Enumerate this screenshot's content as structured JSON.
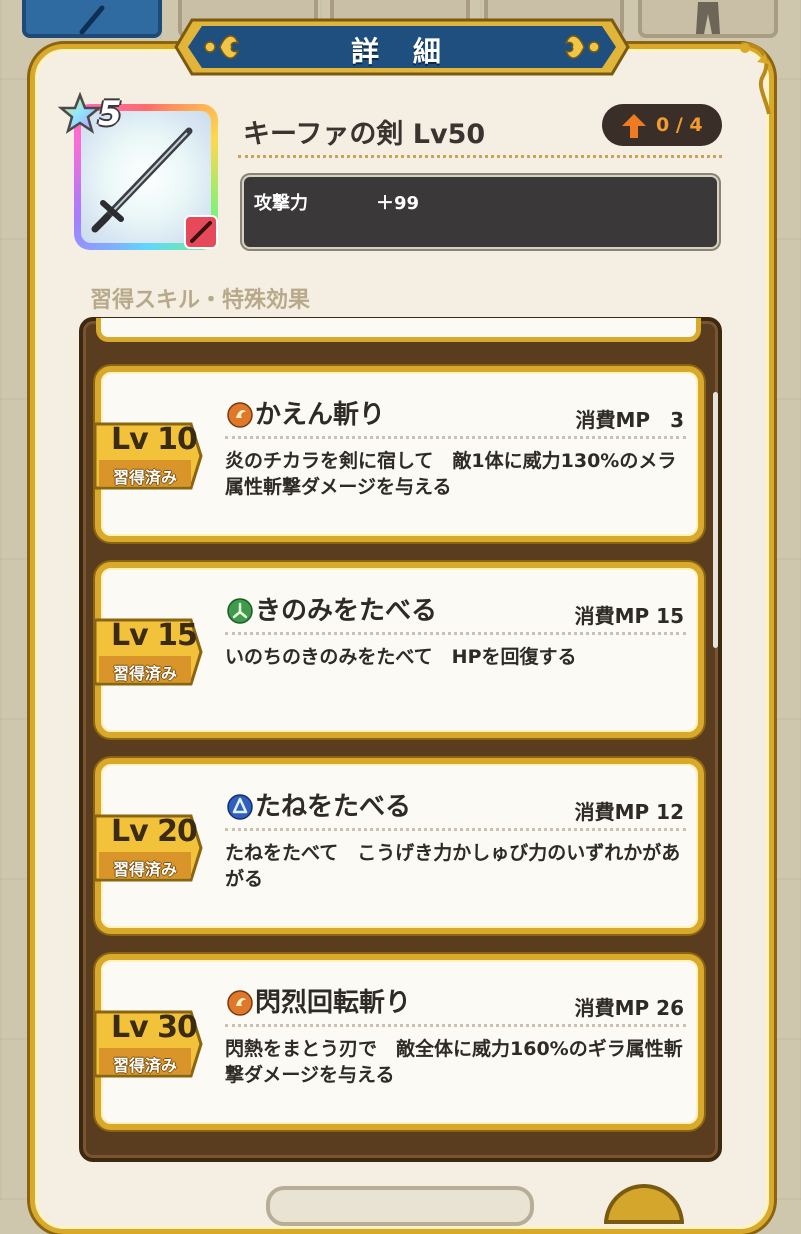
{
  "header": {
    "title": "詳 細"
  },
  "item": {
    "rarity": "5",
    "name": "キーファの剣 Lv50",
    "upgrade": "0 / 4",
    "stat_label": "攻撃力",
    "stat_value": "＋99"
  },
  "section_title": "習得スキル・特殊効果",
  "skills": [
    {
      "lv": "Lv 10",
      "learned": "習得済み",
      "name": "かえん斬り",
      "cost": "消費MP　3",
      "desc": "炎のチカラを剣に宿して　敵1体に威力130%のメラ属性斬撃ダメージを与える",
      "icon_color": "#e0782a"
    },
    {
      "lv": "Lv 15",
      "learned": "習得済み",
      "name": "きのみをたべる",
      "cost": "消費MP 15",
      "desc": "いのちのきのみをたべて　HPを回復する",
      "icon_color": "#3f9a4c"
    },
    {
      "lv": "Lv 20",
      "learned": "習得済み",
      "name": "たねをたべる",
      "cost": "消費MP 12",
      "desc": "たねをたべて　こうげき力かしゅび力のいずれかがあがる",
      "icon_color": "#2f5fbf"
    },
    {
      "lv": "Lv 30",
      "learned": "習得済み",
      "name": "閃烈回転斬り",
      "cost": "消費MP 26",
      "desc": "閃熱をまとう刃で　敵全体に威力160%のギラ属性斬撃ダメージを与える",
      "icon_color": "#e0782a"
    }
  ],
  "colors": {
    "accent_gold": "#d8a92b",
    "banner_blue": "#1f4f7e",
    "frame_brown": "#5a3c1e"
  },
  "icons": [
    "sword-tab-icon",
    "star-icon",
    "sword-icon",
    "up-arrow-icon",
    "fire-skill-icon",
    "heal-skill-icon",
    "buff-skill-icon"
  ]
}
